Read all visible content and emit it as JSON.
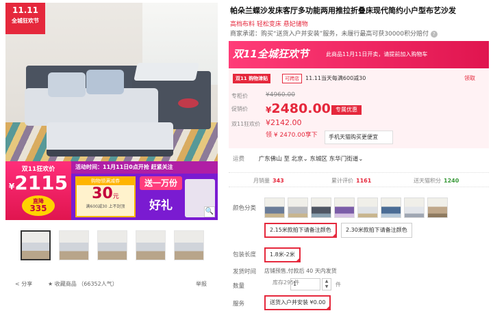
{
  "gallery": {
    "badge_line1": "11.11",
    "badge_line2": "全城狂欢节",
    "promo": {
      "title": "双11狂欢价",
      "currency": "¥",
      "price": "2115",
      "sub_label": "直降",
      "sub_value": "335",
      "activity_time": "活动时间：11月11日0点开抢  赶紧关注",
      "coupon_title": "购物领满减券",
      "coupon_value": "30",
      "coupon_unit": "元",
      "coupon_desc": "满600减30  上不封顶",
      "gift_line1": "送一万份",
      "gift_line2": "好礼"
    },
    "zoom_icon": "search-icon",
    "thumbnail_count": 5
  },
  "share": {
    "share_label": "分享",
    "favorite_label": "收藏商品",
    "favorite_count": "（66352人气）",
    "report_label": "举报"
  },
  "product": {
    "title": "帕朵兰蝶沙发床客厅多功能两用推拉折叠床现代简约小户型布艺沙发",
    "subtitle": "高档布料 轻松变床 悬妃储物",
    "promise": "商家承诺：购买“送货入户并安装”服务，未履行最高可获30000积分赔付",
    "promise_icon": "question-icon"
  },
  "price_box": {
    "banner_logo": "双11全城狂欢节",
    "banner_text": "此商品11月11日开卖，请提前加入购物车",
    "tag_dark": "双11",
    "tag_coupon": "购物津贴",
    "tag_stack": "可跨店",
    "coupon_note": "11.11当天每满600减30",
    "coupon_link": "领取",
    "orig_label": "专柜价",
    "orig_price": "¥4960.00",
    "promo_label": "促销价",
    "promo_currency": "¥",
    "promo_price": "2480.00",
    "promo_tag": "专属优惠",
    "d11_label": "双11狂欢价",
    "d11_price": "¥2142.00",
    "coupon_line": "领 ¥ 2470.00享下",
    "app_button": "手机天猫购买更便宜"
  },
  "delivery": {
    "label": "运费",
    "from": "广东佛山",
    "to_word": "至",
    "to": "北京",
    "district": "东城区",
    "street": "东华门街道"
  },
  "stats": {
    "monthly_label": "月销量",
    "monthly_value": "343",
    "reviews_label": "累计评价",
    "reviews_value": "1161",
    "points_label": "送天猫积分",
    "points_value": "1240"
  },
  "sku": {
    "color_label": "颜色分类",
    "swatch_count": 8,
    "size_option1": "2.15米款拍下请备注颜色",
    "size_option2": "2.30米款拍下请备注颜色",
    "length_label": "包装长度",
    "length_option": "1.8米-2米",
    "ship_label": "发货时间",
    "ship_value": "店铺预售,付款后 40 天内发货",
    "qty_label": "数量",
    "qty_value": "1",
    "stock": "库存295件",
    "unit": "件",
    "service_label": "服务",
    "service_option": "送货入户并安装 ¥0.00"
  },
  "colors": {
    "accent": "#e5283c",
    "promo_purple": "#7a1bd1",
    "stats_green": "#3a9a3a"
  }
}
